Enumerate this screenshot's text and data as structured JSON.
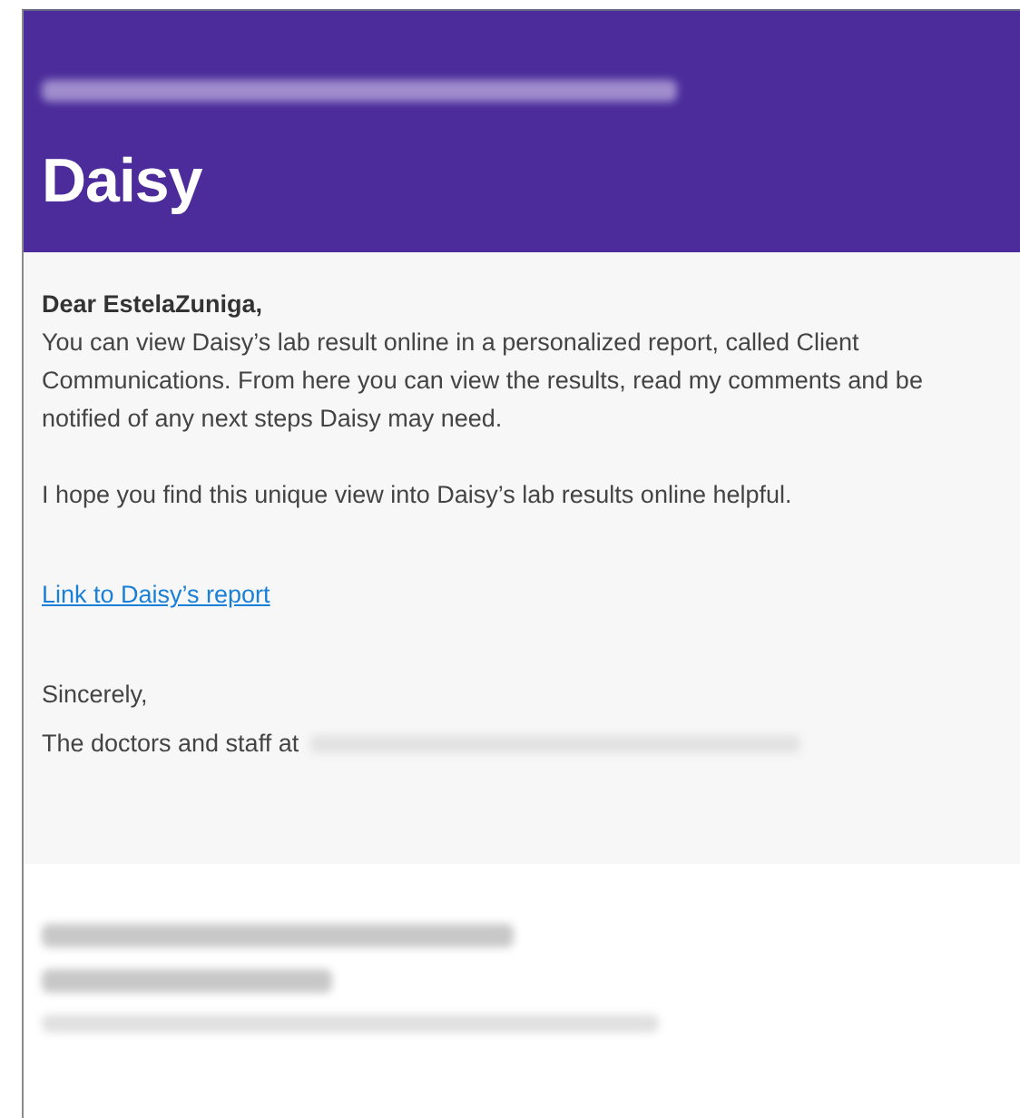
{
  "header": {
    "title": "Daisy"
  },
  "body": {
    "greeting": "Dear EstelaZuniga,",
    "paragraphs": [
      "You can view Daisy’s lab result online in a personalized report, called Client Communications. From here you can view the results, read my comments and be notified of any next steps Daisy may need.",
      "I hope you find this unique view into Daisy’s lab results online helpful."
    ],
    "link": "Link to Daisy’s report",
    "closing": "Sincerely,",
    "signature": "The doctors and staff at"
  }
}
